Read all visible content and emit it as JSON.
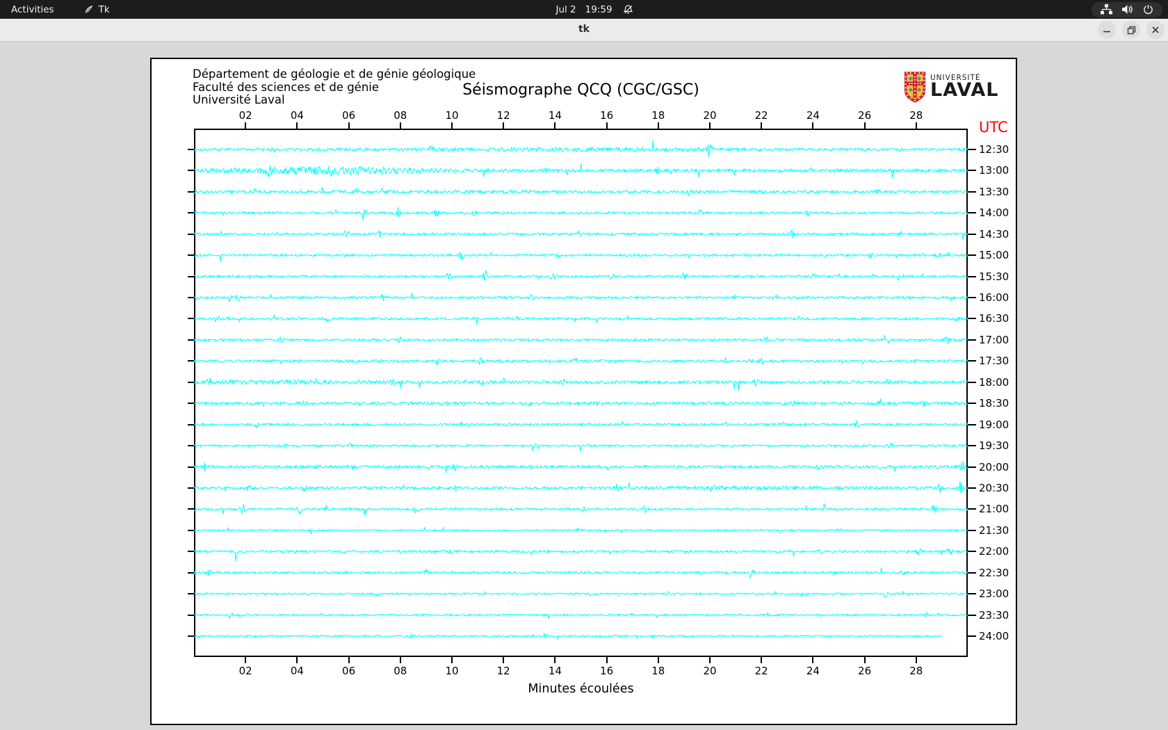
{
  "topbar": {
    "activities": "Activities",
    "app_name": "Tk",
    "date": "Jul 2",
    "time": "19:59"
  },
  "titlebar": {
    "title": "tk"
  },
  "panel": {
    "header_lines": [
      "Département de géologie et de génie géologique",
      "Faculté des sciences et de génie",
      "Université Laval"
    ],
    "title": "Séismographe QCQ (CGC/GSC)",
    "logo": {
      "small": "UNIVERSITÉ",
      "large": "LAVAL"
    }
  },
  "chart_data": {
    "type": "line",
    "title": "Séismographe QCQ (CGC/GSC)",
    "xlabel": "Minutes écoulées",
    "right_axis_label": "UTC",
    "x_range": [
      0,
      30
    ],
    "x_ticks": [
      "02",
      "04",
      "06",
      "08",
      "10",
      "12",
      "14",
      "16",
      "18",
      "20",
      "22",
      "24",
      "26",
      "28"
    ],
    "trace_color": "#00ffff",
    "grid": false,
    "traces": [
      {
        "utc": "12:30",
        "amp": 2.0,
        "seed": 101,
        "events": [
          [
            20.0,
            13
          ],
          [
            9.2,
            4
          ],
          [
            3.1,
            3
          ],
          [
            15.0,
            1.2,
            4
          ]
        ]
      },
      {
        "utc": "13:00",
        "amp": 2.4,
        "seed": 102,
        "events": [
          [
            2.9,
            4
          ],
          [
            5.1,
            4,
            2.5
          ],
          [
            13.6,
            4
          ],
          [
            18.0,
            4
          ],
          [
            26.0,
            3
          ]
        ]
      },
      {
        "utc": "13:30",
        "amp": 2.2,
        "seed": 103,
        "events": [
          [
            6.3,
            4
          ],
          [
            12.0,
            3
          ],
          [
            19.2,
            4
          ],
          [
            26.5,
            3
          ]
        ]
      },
      {
        "utc": "14:00",
        "amp": 1.8,
        "seed": 104,
        "events": [
          [
            6.6,
            6
          ],
          [
            7.9,
            7
          ],
          [
            9.4,
            6
          ],
          [
            10.8,
            4
          ],
          [
            19.6,
            4
          ],
          [
            23.8,
            4
          ]
        ]
      },
      {
        "utc": "14:30",
        "amp": 1.8,
        "seed": 105,
        "events": [
          [
            5.9,
            5
          ],
          [
            7.2,
            4
          ],
          [
            23.2,
            5
          ],
          [
            27.4,
            4
          ]
        ]
      },
      {
        "utc": "15:00",
        "amp": 1.7,
        "seed": 106,
        "events": [
          [
            10.4,
            7
          ],
          [
            14.1,
            3
          ],
          [
            26.2,
            4
          ],
          [
            28.9,
            3
          ]
        ]
      },
      {
        "utc": "15:30",
        "amp": 1.7,
        "seed": 107,
        "events": [
          [
            9.9,
            7
          ],
          [
            11.3,
            8
          ],
          [
            13.9,
            6
          ],
          [
            16.2,
            4
          ],
          [
            19.0,
            5
          ],
          [
            21.6,
            4
          ],
          [
            24.0,
            3
          ]
        ]
      },
      {
        "utc": "16:00",
        "amp": 1.7,
        "seed": 108,
        "events": [
          [
            1.7,
            4
          ],
          [
            7.3,
            5
          ],
          [
            13.1,
            4
          ],
          [
            29.4,
            5
          ]
        ]
      },
      {
        "utc": "16:30",
        "amp": 1.8,
        "seed": 109,
        "events": [
          [
            3.1,
            4
          ],
          [
            5.2,
            4
          ],
          [
            12.5,
            3
          ],
          [
            23.4,
            4
          ],
          [
            29.6,
            4
          ]
        ]
      },
      {
        "utc": "17:00",
        "amp": 1.7,
        "seed": 110,
        "events": [
          [
            3.4,
            4
          ],
          [
            8.0,
            3
          ],
          [
            22.2,
            4
          ],
          [
            29.2,
            6
          ]
        ]
      },
      {
        "utc": "17:30",
        "amp": 2.0,
        "seed": 111,
        "events": [
          [
            9.4,
            5
          ],
          [
            11.1,
            4
          ],
          [
            14.8,
            3
          ],
          [
            22.0,
            4
          ],
          [
            27.9,
            4
          ]
        ]
      },
      {
        "utc": "18:00",
        "amp": 2.2,
        "seed": 112,
        "events": [
          [
            0.6,
            4
          ],
          [
            3.0,
            1,
            3
          ],
          [
            7.7,
            5
          ],
          [
            11.2,
            4
          ],
          [
            14.3,
            4
          ],
          [
            21.8,
            4
          ],
          [
            26.9,
            4
          ]
        ]
      },
      {
        "utc": "18:30",
        "amp": 2.2,
        "seed": 113,
        "events": [
          [
            4.3,
            3
          ],
          [
            13.0,
            4
          ],
          [
            23.3,
            5
          ],
          [
            26.6,
            5
          ],
          [
            28.3,
            4
          ]
        ]
      },
      {
        "utc": "19:00",
        "amp": 1.9,
        "seed": 114,
        "events": [
          [
            2.4,
            3
          ],
          [
            12.2,
            3
          ],
          [
            22.9,
            5
          ],
          [
            25.7,
            4
          ]
        ]
      },
      {
        "utc": "19:30",
        "amp": 1.5,
        "seed": 115,
        "events": [
          [
            3.6,
            3
          ],
          [
            6.1,
            3
          ],
          [
            13.3,
            4
          ],
          [
            27.0,
            3
          ]
        ]
      },
      {
        "utc": "20:00",
        "amp": 2.2,
        "seed": 116,
        "events": [
          [
            0.4,
            5
          ],
          [
            6.2,
            4
          ],
          [
            10.1,
            4
          ],
          [
            16.0,
            4
          ],
          [
            24.2,
            4
          ],
          [
            29.8,
            9
          ]
        ]
      },
      {
        "utc": "20:30",
        "amp": 2.0,
        "seed": 117,
        "events": [
          [
            2.1,
            5
          ],
          [
            4.3,
            4
          ],
          [
            10.2,
            5
          ],
          [
            16.4,
            4
          ],
          [
            20.1,
            4
          ],
          [
            22.0,
            1.2,
            3
          ],
          [
            28.9,
            9
          ],
          [
            29.7,
            8
          ]
        ]
      },
      {
        "utc": "21:00",
        "amp": 1.7,
        "seed": 118,
        "events": [
          [
            1.9,
            6
          ],
          [
            4.1,
            5
          ],
          [
            8.6,
            4
          ],
          [
            15.1,
            4
          ],
          [
            17.5,
            4
          ],
          [
            28.7,
            11
          ]
        ]
      },
      {
        "utc": "21:30",
        "amp": 1.2,
        "seed": 119,
        "events": [
          [
            14.9,
            2
          ],
          [
            25.0,
            2
          ]
        ]
      },
      {
        "utc": "22:00",
        "amp": 1.8,
        "seed": 120,
        "events": [
          [
            1.6,
            4
          ],
          [
            10.0,
            3
          ],
          [
            24.3,
            4
          ],
          [
            28.1,
            6
          ],
          [
            29.3,
            4
          ]
        ]
      },
      {
        "utc": "22:30",
        "amp": 1.8,
        "seed": 121,
        "events": [
          [
            0.6,
            3
          ],
          [
            9.0,
            3
          ],
          [
            21.6,
            6
          ],
          [
            27.5,
            3
          ]
        ]
      },
      {
        "utc": "23:00",
        "amp": 1.3,
        "seed": 122,
        "events": [
          [
            7.1,
            3
          ],
          [
            18.4,
            4
          ],
          [
            26.8,
            4
          ]
        ]
      },
      {
        "utc": "23:30",
        "amp": 1.3,
        "seed": 123,
        "events": [
          [
            1.8,
            3
          ],
          [
            17.0,
            2
          ],
          [
            28.4,
            5
          ]
        ]
      },
      {
        "utc": "24:00",
        "amp": 1.3,
        "seed": 124,
        "end": 29,
        "events": [
          [
            13.6,
            5
          ],
          [
            8.4,
            2
          ]
        ]
      }
    ]
  },
  "colors": {
    "trace": "#00ffff",
    "utc_label": "#ff0000",
    "panel_bg": "#ffffff",
    "window_bg": "#d8d8d8",
    "topbar_bg": "#1c1c1c",
    "titlebar_bg": "#ebebeb",
    "logo_red": "#d02030",
    "logo_gold": "#f2c12e",
    "logo_blue": "#2e86c1"
  }
}
